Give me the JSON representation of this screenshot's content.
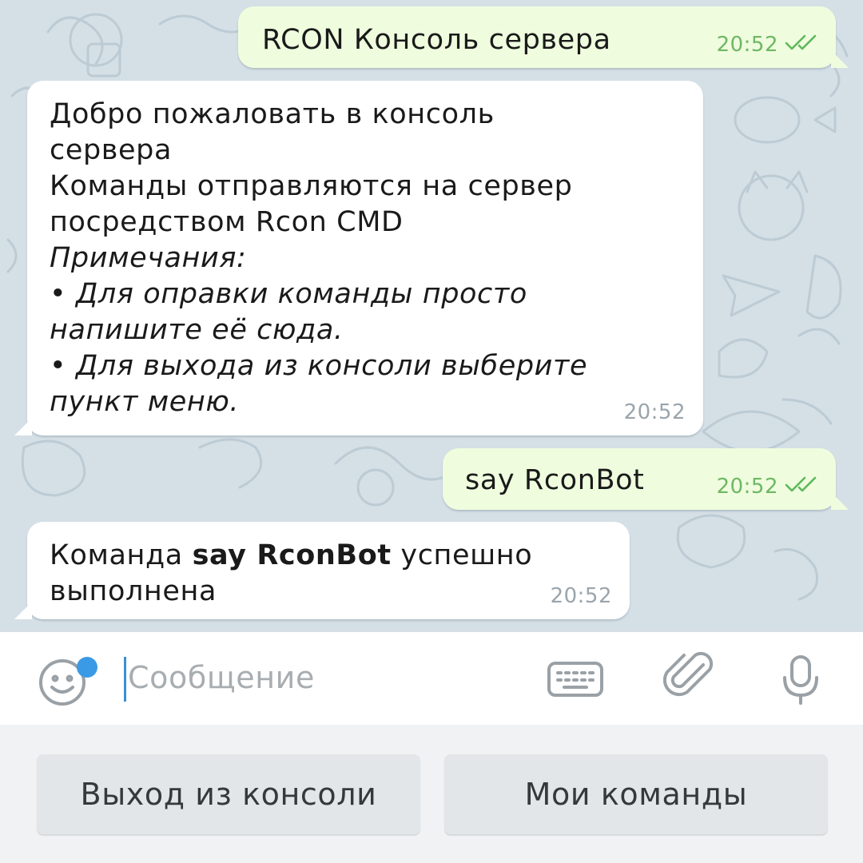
{
  "messages": [
    {
      "direction": "outgoing",
      "text": "RCON Консоль сервера",
      "time": "20:52",
      "status": "read-double-check"
    },
    {
      "direction": "incoming",
      "lines": [
        "Добро пожаловать в консоль",
        "сервера",
        "Команды отправляются на сервер",
        "посредством Rcon CMD",
        "Примечания:",
        "• Для оправки команды просто",
        "напишите её сюда.",
        "• Для выхода из консоли выберите",
        "пункт меню."
      ],
      "time": "20:52"
    },
    {
      "direction": "outgoing",
      "text": "say RconBot",
      "time": "20:52",
      "status": "read-double-check"
    },
    {
      "direction": "incoming",
      "parts": {
        "prefix": "Команда ",
        "bold": "say RconBot",
        "suffix": " успешно",
        "line2": "выполнена"
      },
      "time": "20:52"
    }
  ],
  "input": {
    "placeholder": "Сообщение",
    "value": ""
  },
  "icons": {
    "emoji": "smiley-face-icon",
    "keyboard": "keyboard-icon",
    "attach": "paperclip-icon",
    "mic": "microphone-icon",
    "read_status": "double-check-icon"
  },
  "bot_keyboard": {
    "buttons": [
      "Выход из консоли",
      "Мои команды"
    ]
  },
  "colors": {
    "outgoing_bubble": "#effdde",
    "incoming_bubble": "#ffffff",
    "check_green": "#5fb85c",
    "accent_blue": "#3b9ae5",
    "wallpaper": "#d5dfe6"
  }
}
